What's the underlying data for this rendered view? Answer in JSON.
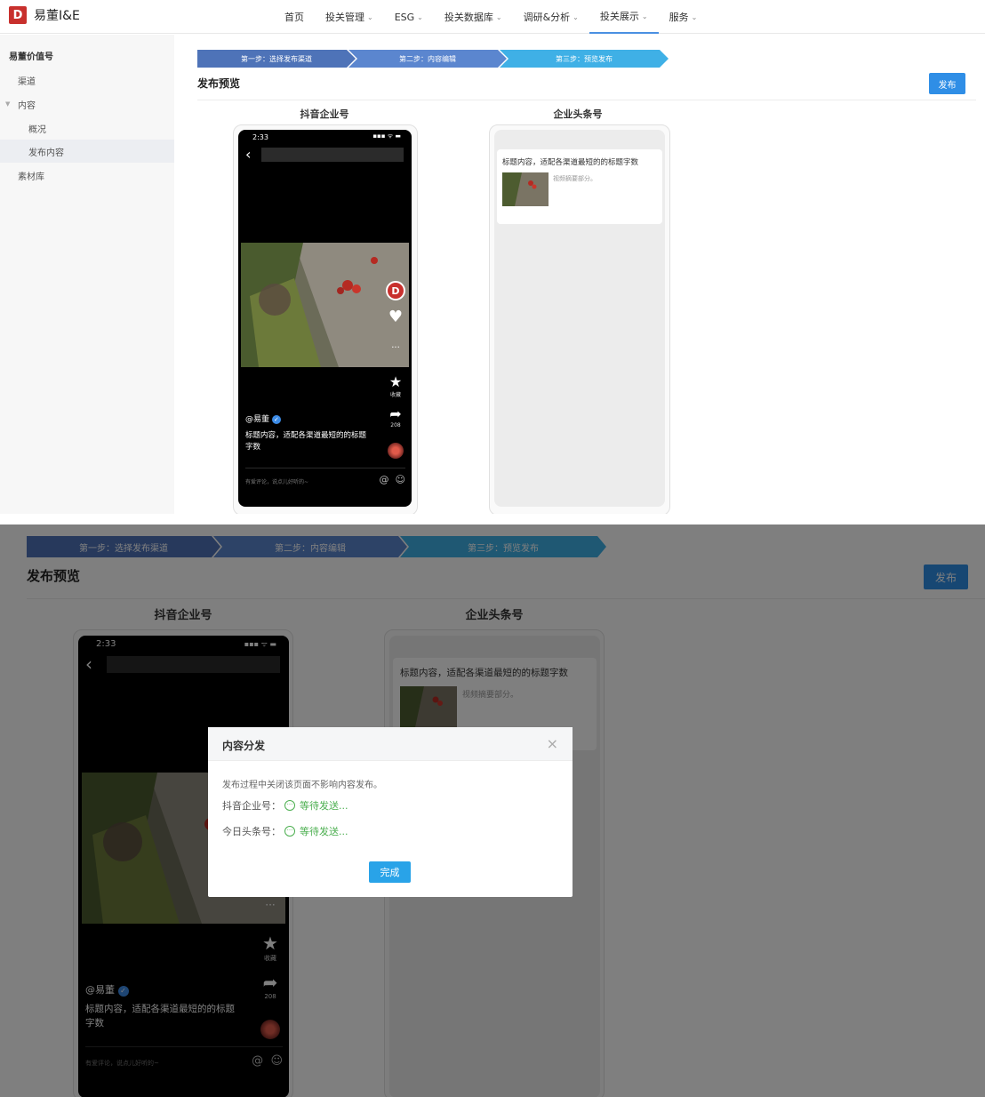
{
  "app": {
    "logo_mark": "D",
    "logo_text": "易董I&E"
  },
  "nav": {
    "items": [
      {
        "label": "首页",
        "chevron": false
      },
      {
        "label": "投关管理",
        "chevron": true
      },
      {
        "label": "ESG",
        "chevron": true
      },
      {
        "label": "投关数据库",
        "chevron": true
      },
      {
        "label": "调研&分析",
        "chevron": true
      },
      {
        "label": "投关展示",
        "chevron": true,
        "active": true
      },
      {
        "label": "服务",
        "chevron": true
      }
    ]
  },
  "sidebar": {
    "title": "易董价值号",
    "items": [
      "渠道",
      "内容",
      "概况",
      "发布内容",
      "素材库"
    ]
  },
  "steps": [
    "第一步：选择发布渠道",
    "第二步：内容编辑",
    "第三步：预览发布"
  ],
  "colors": {
    "step1": "#4e73b8",
    "step2": "#5b86cf",
    "step3": "#3fb0e6",
    "accent": "#2f8ee6",
    "pending": "#4caf50"
  },
  "preview": {
    "title": "发布预览",
    "publish_label": "发布",
    "douyin_label": "抖音企业号",
    "toutiao_label": "企业头条号"
  },
  "douyin": {
    "time": "2:33",
    "status": "▪▪▪ ᯤ ▬",
    "back": "‹",
    "collect_label": "收藏",
    "share_count": "208",
    "author": "@易董",
    "caption": "标题内容，适配各渠道最短的的标题字数",
    "comment_placeholder": "有爱评论，说点儿好听的~",
    "icons": {
      "heart": "♥",
      "comment": "···",
      "star": "★",
      "share": "➦",
      "at": "@",
      "emoji": "☺",
      "verify": "✓"
    }
  },
  "toutiao": {
    "title": "标题内容，适配各渠道最短的的标题字数",
    "summary": "视频摘要部分。"
  },
  "modal": {
    "title": "内容分发",
    "close": "×",
    "note": "发布过程中关闭该页面不影响内容发布。",
    "rows": [
      {
        "channel": "抖音企业号：",
        "status": "等待发送..."
      },
      {
        "channel": "今日头条号：",
        "status": "等待发送..."
      }
    ],
    "pending_icon": "···",
    "done_label": "完成"
  }
}
